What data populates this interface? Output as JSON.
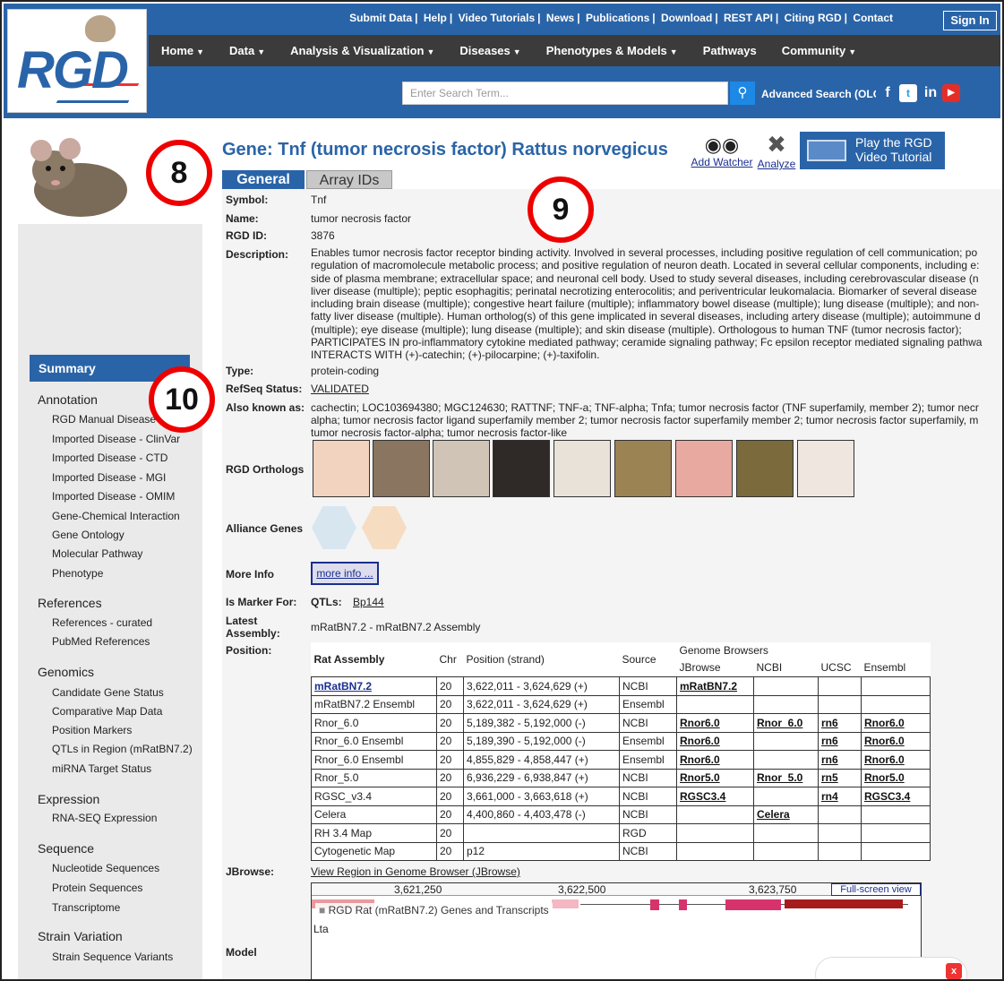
{
  "header": {
    "top_links": [
      "Submit Data",
      "Help",
      "Video Tutorials",
      "News",
      "Publications",
      "Download",
      "REST API",
      "Citing RGD",
      "Contact"
    ],
    "sign_in": "Sign In",
    "nav": [
      "Home",
      "Data",
      "Analysis & Visualization",
      "Diseases",
      "Phenotypes & Models",
      "Pathways",
      "Community"
    ],
    "search_placeholder": "Enter Search Term...",
    "advanced_search": "Advanced Search (OLG",
    "social": [
      "f",
      "t",
      "in",
      "▶"
    ],
    "logo_text": "RGD"
  },
  "badges": [
    "8",
    "9",
    "10"
  ],
  "sidebar": {
    "active": "Summary",
    "sections": [
      {
        "title": "Annotation",
        "items": [
          "RGD Manual Disease",
          "Imported Disease - ClinVar",
          "Imported Disease - CTD",
          "Imported Disease - MGI",
          "Imported Disease - OMIM",
          "Gene-Chemical Interaction",
          "Gene Ontology",
          "Molecular Pathway",
          "Phenotype"
        ]
      },
      {
        "title": "References",
        "items": [
          "References - curated",
          "PubMed References"
        ]
      },
      {
        "title": "Genomics",
        "items": [
          "Candidate Gene Status",
          "Comparative Map Data",
          "Position Markers",
          "QTLs in Region (mRatBN7.2)",
          "miRNA Target Status"
        ]
      },
      {
        "title": "Expression",
        "items": [
          "RNA-SEQ Expression"
        ]
      },
      {
        "title": "Sequence",
        "items": [
          "Nucleotide Sequences",
          "Protein Sequences",
          "Transcriptome"
        ]
      },
      {
        "title": "Strain Variation",
        "items": [
          "Strain Sequence Variants"
        ]
      }
    ]
  },
  "gene": {
    "title": "Gene: Tnf (tumor necrosis factor) Rattus norvegicus",
    "add_watcher": "Add Watcher",
    "analyze": "Analyze",
    "video": "Play the RGD Video Tutorial",
    "tabs": [
      "General",
      "Array IDs"
    ],
    "labels": {
      "symbol": "Symbol:",
      "name": "Name:",
      "rgd_id": "RGD ID:",
      "description": "Description:",
      "type": "Type:",
      "refseq": "RefSeq Status:",
      "aka": "Also known as:",
      "orthologs": "RGD Orthologs",
      "alliance": "Alliance Genes",
      "more_info": "More Info",
      "marker": "Is Marker For:",
      "assembly": "Latest Assembly:",
      "position": "Position:",
      "jbrowse": "JBrowse:",
      "model": "Model"
    },
    "symbol": "Tnf",
    "name": "tumor necrosis factor",
    "rgd_id": "3876",
    "description": "Enables tumor necrosis factor receptor binding activity. Involved in several processes, including positive regulation of cell communication; po regulation of macromolecule metabolic process; and positive regulation of neuron death. Located in several cellular components, including e: side of plasma membrane; extracellular space; and neuronal cell body. Used to study several diseases, including cerebrovascular disease (n liver disease (multiple); peptic esophagitis; perinatal necrotizing enterocolitis; and periventricular leukomalacia. Biomarker of several disease including brain disease (multiple); congestive heart failure (multiple); inflammatory bowel disease (multiple); lung disease (multiple); and non- fatty liver disease (multiple). Human ortholog(s) of this gene implicated in several diseases, including artery disease (multiple); autoimmune d (multiple); eye disease (multiple); lung disease (multiple); and skin disease (multiple). Orthologous to human TNF (tumor necrosis factor); PARTICIPATES IN pro-inflammatory cytokine mediated pathway; ceramide signaling pathway; Fc epsilon receptor mediated signaling pathwa INTERACTS WITH (+)-catechin; (+)-pilocarpine; (+)-taxifolin.",
    "type": "protein-coding",
    "refseq": "VALIDATED",
    "aka": "cachectin; LOC103694380; MGC124630; RATTNF; TNF-a; TNF-alpha; Tnfa; tumor necrosis factor (TNF superfamily, member 2); tumor necr alpha; tumor necrosis factor ligand superfamily member 2; tumor necrosis factor superfamily member 2; tumor necrosis factor superfamily, m tumor necrosis factor-alpha; tumor necrosis factor-like",
    "more_info_btn": "more info ...",
    "marker_prefix": "QTLs:",
    "marker_link": "Bp144",
    "assembly": "mRatBN7.2 - mRatBN7.2 Assembly",
    "jbrowse_link": "View Region in Genome Browser (JBrowse)"
  },
  "position_table": {
    "group_header": "Genome Browsers",
    "headers": [
      "Rat Assembly",
      "Chr",
      "Position (strand)",
      "Source",
      "JBrowse",
      "NCBI",
      "UCSC",
      "Ensembl"
    ],
    "rows": [
      [
        "mRatBN7.2",
        "20",
        "3,622,011 - 3,624,629 (+)",
        "NCBI",
        "mRatBN7.2",
        "",
        "",
        ""
      ],
      [
        "mRatBN7.2 Ensembl",
        "20",
        "3,622,011 - 3,624,629 (+)",
        "Ensembl",
        "",
        "",
        "",
        ""
      ],
      [
        "Rnor_6.0",
        "20",
        "5,189,382 - 5,192,000 (-)",
        "NCBI",
        "Rnor6.0",
        "Rnor_6.0",
        "rn6",
        "Rnor6.0"
      ],
      [
        "Rnor_6.0 Ensembl",
        "20",
        "5,189,390 - 5,192,000 (-)",
        "Ensembl",
        "Rnor6.0",
        "",
        "rn6",
        "Rnor6.0"
      ],
      [
        "Rnor_6.0 Ensembl",
        "20",
        "4,855,829 - 4,858,447 (+)",
        "Ensembl",
        "Rnor6.0",
        "",
        "rn6",
        "Rnor6.0"
      ],
      [
        "Rnor_5.0",
        "20",
        "6,936,229 - 6,938,847 (+)",
        "NCBI",
        "Rnor5.0",
        "Rnor_5.0",
        "rn5",
        "Rnor5.0"
      ],
      [
        "RGSC_v3.4",
        "20",
        "3,661,000 - 3,663,618 (+)",
        "NCBI",
        "RGSC3.4",
        "",
        "rn4",
        "RGSC3.4"
      ],
      [
        "Celera",
        "20",
        "4,400,860 - 4,403,478 (-)",
        "NCBI",
        "",
        "Celera",
        "",
        ""
      ],
      [
        "RH 3.4 Map",
        "20",
        "",
        "RGD",
        "",
        "",
        "",
        ""
      ],
      [
        "Cytogenetic Map",
        "20",
        "p12",
        "NCBI",
        "",
        "",
        "",
        ""
      ]
    ]
  },
  "jbrowse_view": {
    "ticks": [
      "3,621,250",
      "3,622,500",
      "3,623,750"
    ],
    "full_screen": "Full-screen view",
    "track_label": "RGD Rat (mRatBN7.2) Genes and Transcripts",
    "feature_label": "Lta"
  },
  "colors": {
    "brand_blue": "#2a64a8",
    "nav_dark": "#3b3b3b",
    "badge_red": "#e00000"
  }
}
